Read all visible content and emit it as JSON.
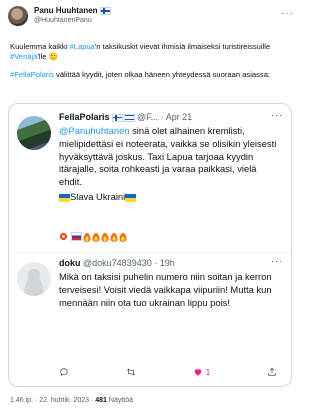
{
  "header": {
    "display_name": "Panu Huuhtanen",
    "handle": "@HuuhtanenPanu",
    "flag_icon": "finland-flag-icon"
  },
  "tweet": {
    "line1_pre": "Kuulemma kaikki ",
    "line1_tag": "#Lapua",
    "line1_mid": "'n taksikuskit vievät ihmisiä ilmaiseksi turistireissuille ",
    "line1_tag2": "#Venäjä",
    "line1_post": "'lle",
    "line1_emoji": "🙂",
    "line2_tag": "#FellaPolaris",
    "line2_rest": " välittää kyydit, joten olkaa häneen yhteydessä suoraan asiassa:"
  },
  "quote1": {
    "name": "FellaPolaris",
    "handle_short": "@F...",
    "sep": "·",
    "date": "Apr 21",
    "mention": "@Panuhuhtanen",
    "body": " sinä olet alhainen kremlisti, mielipidettäsi ei noteerata, vaikka se olisikin yleisesti hyväksyttävä joskus. Taxi Lapua tarjoaa kyydin itärajalle, soita rohkeasti ja varaa paikkasi, vielä ehdit.",
    "slava": "Slava Ukraini"
  },
  "quote2": {
    "name": "doku",
    "handle": "@doku74839430",
    "sep": "·",
    "time": "19h",
    "body": "Mikä on taksisi puhelin numero niin soitan ja kerron terveisesi! Voisit viedä  vaikkapa viipuriin! Mutta kun mennään niin ota tuo ukrainan lippu pois!",
    "reply_count": "",
    "retweet_count": "",
    "like_count": "1"
  },
  "footer": {
    "time": "1.46 ip.",
    "sep1": " · ",
    "date": "22. huhtik. 2023",
    "sep2": " · ",
    "views_count": "481",
    "views_label": " Näyttöä"
  },
  "colors": {
    "accent": "#1d9bf0",
    "text": "#0f1419",
    "muted": "#536471",
    "like": "#f91880"
  }
}
